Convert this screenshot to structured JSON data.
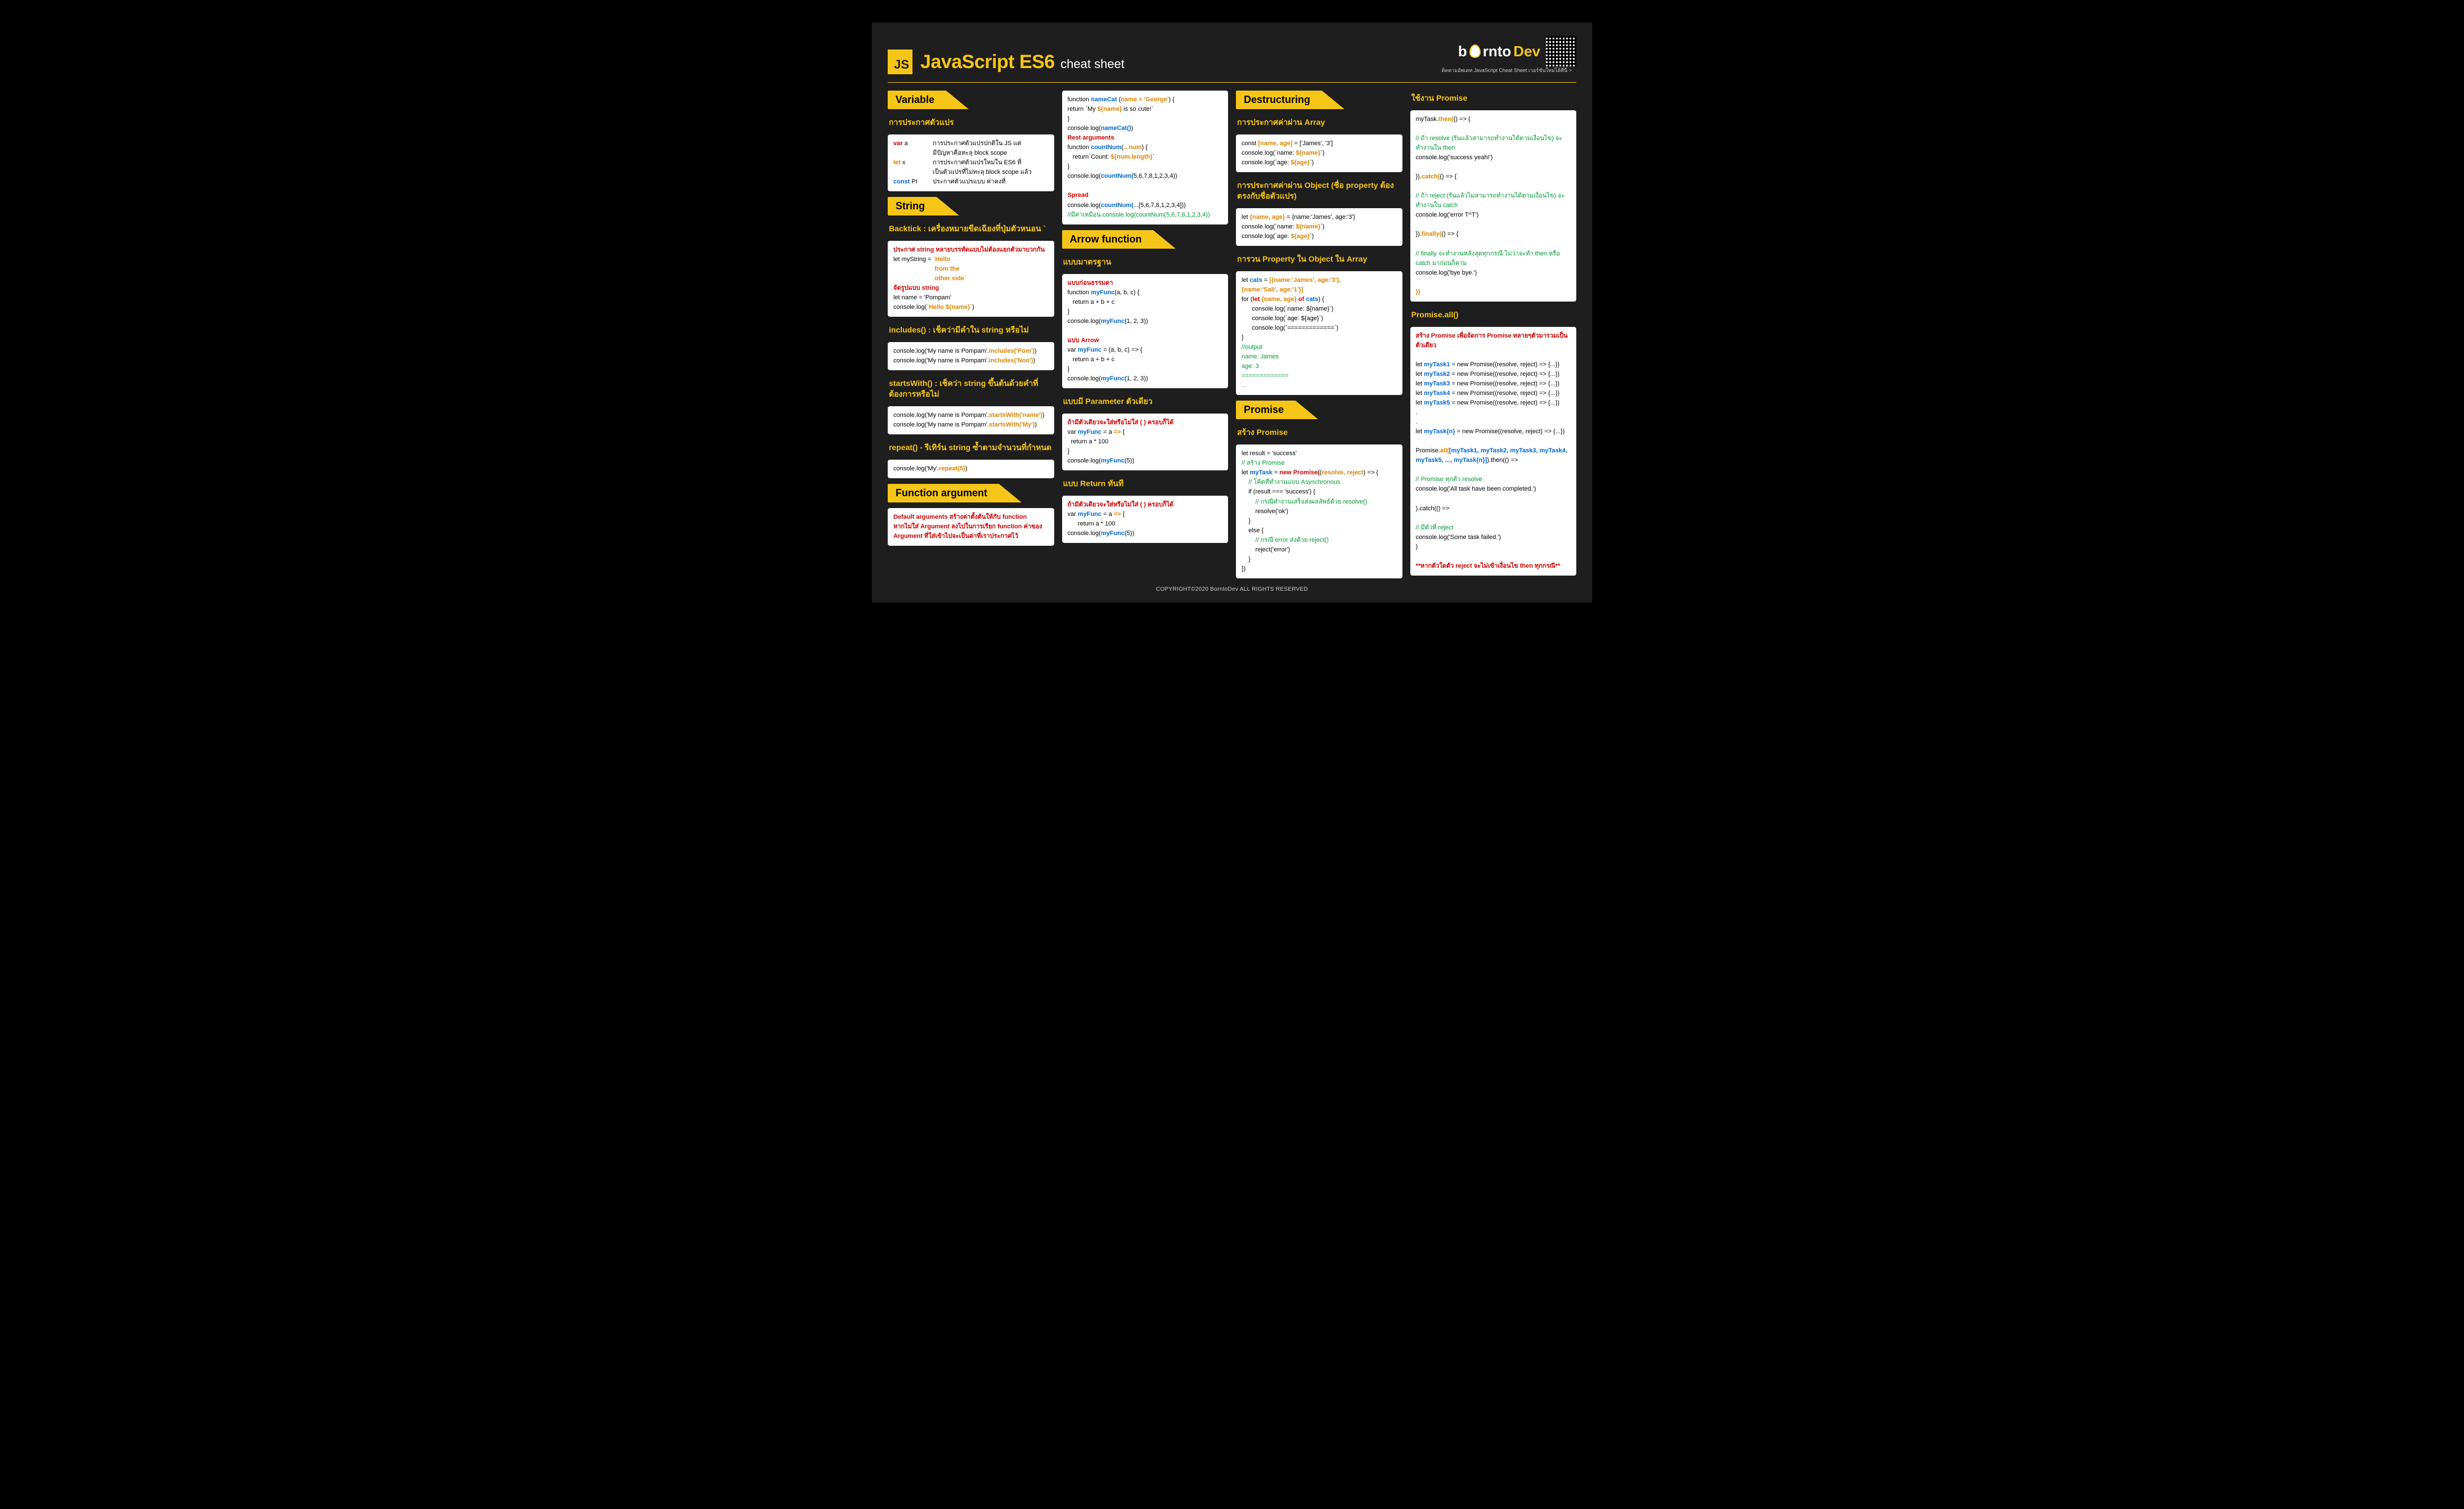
{
  "header": {
    "badge": "JS",
    "title": "JavaScript ES6",
    "subtitle": "cheat sheet",
    "brand_born": "b",
    "brand_rnto": "rnto",
    "brand_dev": "Dev",
    "tagline": "ติดตามอัพเดท JavaScript Cheat Sheet เวอร์ชันใหม่ได้ที่นี่ >"
  },
  "footer": "COPYRIGHT©2020 BorntoDev ALL RIGHTS RESERVED",
  "col1": {
    "sec1": {
      "tab": "Variable"
    },
    "sub1": "การประกาศตัวแปร",
    "vars": {
      "r": "var",
      "r_a": "a",
      "o": "let",
      "o_x": "x",
      "b": "const",
      "b_pi": "PI",
      "d1": "การประกาศตัวแปรปกติใน JS แต่",
      "d2": "มีปัญหาคือทะลุ​ block scope",
      "d3": "การประกาศตัวแปรใหม่ใน ES6 ที่",
      "d4": "เป็นตัวแปรที่ไม่ทะลุ block scope แล้ว",
      "d5": "ประกาศตัวแปรแบบ ค่าคงที่"
    },
    "sec2": {
      "tab": "String"
    },
    "sub2": "Backtick : เครื่องหมายขีดเฉียงที่ปุ่มตัวหนอน `",
    "backtick": {
      "l1": "ประกาศ string หลายบรรทัดแบบไม่ต้องแยกตัวมาบวกกัน",
      "l2a": "let myString = ",
      "l2b": "`Hello",
      "l3": "                        from the",
      "l4": "                        other side`",
      "l5": "จัดรูปแบบ string",
      "l6": "let name = 'Pompam'",
      "l7a": "console.log(",
      "l7b": "`Hello ${name}`",
      "l7c": ")"
    },
    "sub3": "includes() : เช็คว่ามีคำใน string หรือไม่",
    "includes": {
      "l1a": "console.log('My name is Pompam'.",
      "l1b": "includes('Pom')",
      "l1c": ")",
      "l2a": "console.log('My name is Pompam'.",
      "l2b": "includes('Noo')",
      "l2c": ")"
    },
    "sub4": "startsWith() : เช็คว่า string ขึ้นต้นด้วยคำที่ต้องการหรือไม่",
    "startswith": {
      "l1a": "console.log('My name is Pompam'.",
      "l1b": "startsWith('name')",
      "l1c": ")",
      "l2a": "console.log('My name is Pompam'.",
      "l2b": "startsWith('My')",
      "l2c": ")"
    },
    "sub5": "repeat() - รีเทิร์น string ซ้ำตามจำนวนที่กำหนด",
    "repeat": {
      "l1a": "console.log('My'.",
      "l1b": "repeat(5)",
      "l1c": ")"
    },
    "sec3": {
      "tab": "Function argument"
    },
    "funarg": {
      "l1": "Default arguments สร้างค่าตั้งต้นให้กับ function",
      "l2": "หากไม่ใส่ Argument ลงไปในการเรียก function ค่าของ",
      "l3": "Argument ที่ใส่เข้าไปจะเป็นค่าที่เราประกาศไว้"
    }
  },
  "col2": {
    "defaultargs": {
      "l1a": "function ",
      "l1b": "nameCat ",
      "l1c": "(",
      "l1d": "name = 'George'",
      "l1e": ") {",
      "l2a": "return `My ",
      "l2b": "${name}",
      "l2c": " is so cute!`",
      "l3": "}",
      "l4a": "console.log(",
      "l4b": "nameCat()",
      "l4c": ")",
      "l5": "Rest arguments",
      "l6a": "function ",
      "l6b": "countNum",
      "l6c": "(",
      "l6d": "...num",
      "l6e": ") {",
      "l7a": "   return`Count: ",
      "l7b": "${num.length}",
      "l7c": "`",
      "l8": "}",
      "l9a": "console.log(",
      "l9b": "countNum(",
      "l9c": "5,6,7,8,1,2,3,4",
      "l9d": "))",
      "l10": "Spread",
      "l11a": "console.log(",
      "l11b": "countNum(",
      "l11c": "...[5,6,7,8,1,2,3,4]",
      "l11d": "))",
      "l12": "//มีค่าเหมือน console.log(countNum(5,6,7,8,1,2,3,4))"
    },
    "sec1": {
      "tab": "Arrow function"
    },
    "sub1": "แบบมาตรฐาน",
    "arrowstd": {
      "l1": "แบบก่อนธรรมดา",
      "l2a": "function ",
      "l2b": "myFunc",
      "l2c": "(a, b, c) {",
      "l3": "   return a + b + c",
      "l4": "}",
      "l5a": "console.log(",
      "l5b": "myFunc(",
      "l5c": "1, 2, 3",
      "l5d": "))",
      "l6": "แบบ Arrow",
      "l7a": "var ",
      "l7b": "myFunc",
      "l7c": " = (a, b, c) => {",
      "l8": "   return a + b + c",
      "l9": "}",
      "l10a": "console.log(",
      "l10b": "myFunc(",
      "l10c": "1, 2, 3",
      "l10d": "))"
    },
    "sub2": "แบบมี Parameter ตัวเดียว",
    "arrowone": {
      "l1": "ถ้ามีตัวเดียวจะใส่หรือไม่ใส่ ( ) ครอบก็ได้",
      "l2a": "var ",
      "l2b": "myFunc",
      "l2c": " = a ",
      "l2d": "=>",
      "l2e": " {",
      "l3": "  return a * 100",
      "l4": "}",
      "l5a": "console.log(",
      "l5b": "myFunc(",
      "l5c": "5",
      "l5d": "))"
    },
    "sub3": "แบบ Return ทันที",
    "arrowret": {
      "l1": "ถ้ามีตัวเดียวจะใส่หรือไม่ใส่ ( ) ครอบก็ได้",
      "l2a": "var ",
      "l2b": "myFunc",
      "l2c": " = a ",
      "l2d": "=>",
      "l2e": " {",
      "l3": "      return a * 100",
      "l5a": "console.log(",
      "l5b": "myFunc(",
      "l5c": "5",
      "l5d": "))"
    }
  },
  "col3": {
    "sec1": {
      "tab": "Destructuring"
    },
    "sub1": "การประกาศค่าผ่าน Array",
    "arr": {
      "l1a": "const ",
      "l1b": "[name, age]",
      "l1c": " = ['James', '3']",
      "l2a": "console.log(`name: ",
      "l2b": "${name}",
      "l2c": "`)",
      "l3a": "console.log(`age: ",
      "l3b": "${age}",
      "l3c": "`)"
    },
    "sub2": "การประกาศค่าผ่าน Object (ชื่อ property ต้องตรงกับชื่อตัวแปร)",
    "obj": {
      "l1a": "let ",
      "l1b": "{name, age}",
      "l1c": " = {name:'James', age:'3'}",
      "l2a": "console.log(`name: ",
      "l2b": "${name}",
      "l2c": "`)",
      "l3a": "console.log(`age: ",
      "l3b": "${age}",
      "l3c": "`)"
    },
    "sub3": "การวน Property ใน Object ใน Array",
    "loop": {
      "l1a": "let ",
      "l1b": "cats",
      "l1c": " = ",
      "l1d": "[{name:'James', age:'3'},",
      "l1e": "{name:'Sali', age:'1'}]",
      "l2a": "for (",
      "l2b": "let ",
      "l2c": "{name, age}",
      "l2d": " of ",
      "l2e": "cats",
      "l2f": ") {",
      "l3": "      console.log(`name: ${name}`)",
      "l4": "      console.log(`age: ${age}`)",
      "l5": "      console.log(`=============`)",
      "l6": "}",
      "l7": "//output",
      "l8": "name: James",
      "l9": "age: 3",
      "l10": "=============",
      "l11": "..."
    },
    "sec2": {
      "tab": "Promise"
    },
    "sub4": "สร้าง Promise",
    "make": {
      "l1": "let result = 'success'",
      "l2": "// สร้าง Promise",
      "l3a": "let ",
      "l3b": "myTask",
      "l3c": " = ",
      "l3d": "new Promise(",
      "l3e": "(",
      "l3f": "resolve, reject",
      "l3g": ") => {",
      "l4": "    // โค้ดที่ทำงานแบบ Asynchronous",
      "l5": "    if (result === 'success') {",
      "l6": "        // กรณีทำงานเสร็จส่งผลลัพธ์ด้วย resolve()",
      "l7": "        resolve('ok')",
      "l8": "    }",
      "l9": "    else {",
      "l10": "        // กรณี error ส่งด้วย reject()",
      "l11": "        reject('error')",
      "l12": "    }",
      "l13": "})"
    }
  },
  "col4": {
    "sub1": "ใช้งาน Promise",
    "use": {
      "l1a": "myTask.",
      "l1b": "then(",
      "l1c": "() => {",
      "l2": "// ถ้า resolve (รันแล้วสามารถทำงานได้ตามเงื่อนไข) จะทำงานใน then",
      "l3": "console.log('success yeah!')",
      "l4a": "}).",
      "l4b": "catch(",
      "l4c": "() => {",
      "l5": "// ถ้า reject (รันแล้วไม่สามารถทำงานได้ตามเงื่อนไข) จะทำงานใน catch",
      "l6": "console.log('error T^T')",
      "l7a": "}).",
      "l7b": "finally(",
      "l7c": "() => {",
      "l8": "// finally จะทำงานหลังสุดทุกกรณี ไม่ว่าจะทำ then หรือ catch มาก่อนก็ตาม",
      "l9": "console.log('bye bye.')",
      "l10": "})"
    },
    "sub2": "Promise.all()",
    "all": {
      "l1": "สร้าง Promise เพื่อจัดการ Promise หลายๆตัวมารวมเป็นตัวเดียว",
      "l2a": "let ",
      "l2b": "myTask1",
      "l2c": " = new Promise((resolve, reject) => {...})",
      "l3a": "let ",
      "l3b": "myTask2",
      "l3c": " = new Promise((resolve, reject) => {...})",
      "l4a": "let ",
      "l4b": "myTask3",
      "l4c": " = new Promise((resolve, reject) => {...})",
      "l5a": "let ",
      "l5b": "myTask4",
      "l5c": " = new Promise((resolve, reject) => {...})",
      "l6a": "let ",
      "l6b": "myTask5",
      "l6c": " = new Promise((resolve, reject) => {...})",
      "l7": ".",
      "l8": ".",
      "l9a": "let ",
      "l9b": "myTask{n}",
      "l9c": " = new Promise((resolve, reject) => {...})",
      "l10a": "Promise.",
      "l10b": "all(",
      "l10c": "[myTask1, myTask2, myTask3, myTask4, myTask5, ..., myTask{n}]",
      "l10d": ").then(() =>",
      "l11": "// Promise ทุกตัว resolve",
      "l12": "console.log('All task have been completed.')",
      "l13": ").catch(() =>",
      "l14": "// มีตัวที่ reject",
      "l15": "console.log('Some task failed.')",
      "l16": ")",
      "l17": "**หากตัวใดตัว reject จะไม่เข้าเงื่อนไข then ทุกกรณี**"
    }
  }
}
